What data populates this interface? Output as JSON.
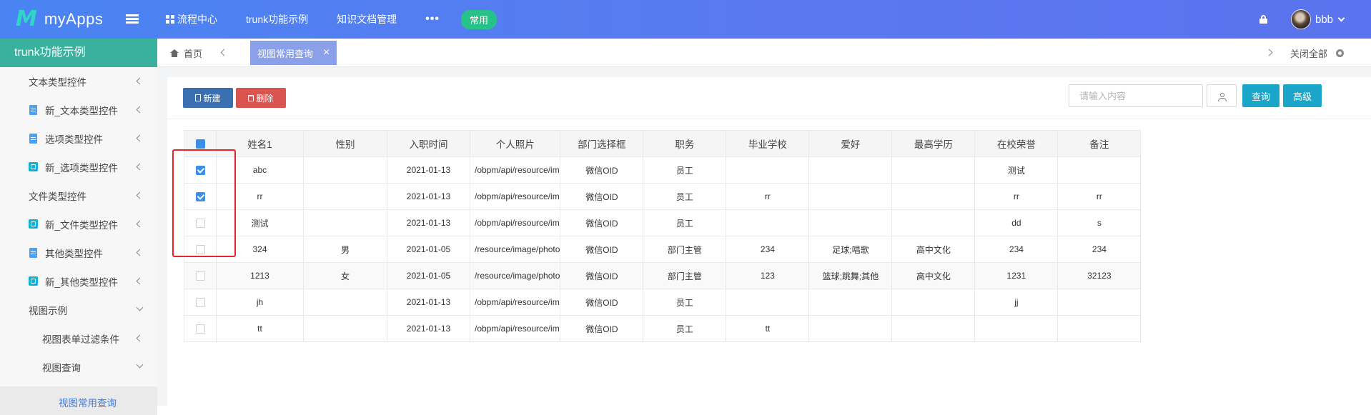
{
  "app": {
    "logo_mark": "M",
    "name": "myApps"
  },
  "topnav": {
    "items": [
      "流程中心",
      "trunk功能示例",
      "知识文档管理"
    ],
    "more": "•••",
    "pill": "常用"
  },
  "user": {
    "name": "bbb"
  },
  "sidebar": {
    "title": "trunk功能示例",
    "items": [
      {
        "label": "文本类型控件",
        "icon": "none",
        "arrow": "left"
      },
      {
        "label": "新_文本类型控件",
        "icon": "doc-icon",
        "arrow": "left"
      },
      {
        "label": "选项类型控件",
        "icon": "doc-icon",
        "arrow": "left"
      },
      {
        "label": "新_选项类型控件",
        "icon": "cube-icon",
        "arrow": "left"
      },
      {
        "label": "文件类型控件",
        "icon": "none",
        "arrow": "left"
      },
      {
        "label": "新_文件类型控件",
        "icon": "cube-icon",
        "arrow": "left"
      },
      {
        "label": "其他类型控件",
        "icon": "doc-icon",
        "arrow": "left"
      },
      {
        "label": "新_其他类型控件",
        "icon": "cube-icon",
        "arrow": "left"
      },
      {
        "label": "视图示例",
        "icon": "none",
        "arrow": "down"
      },
      {
        "label": "视图表单过滤条件",
        "icon": "none",
        "arrow": "left"
      },
      {
        "label": "视图查询",
        "icon": "none",
        "arrow": "down"
      },
      {
        "label": "视图常用查询",
        "icon": "none",
        "arrow": "none"
      }
    ]
  },
  "tabs": {
    "home": "首页",
    "active": "视图常用查询",
    "close_symbol": "×",
    "close_all": "关闭全部"
  },
  "toolbar": {
    "new_label": "新建",
    "delete_label": "删除",
    "search_placeholder": "请输入内容",
    "query_label": "查询",
    "advanced_label": "高级"
  },
  "table": {
    "columns": [
      "姓名1",
      "性别",
      "入职时间",
      "个人照片",
      "部门选择框",
      "职务",
      "毕业学校",
      "爱好",
      "最高学历",
      "在校荣誉",
      "备注"
    ],
    "rows": [
      {
        "checked": true,
        "cells": [
          "abc",
          "",
          "2021-01-13",
          "/obpm/api/resource/im",
          "微信OID",
          "员工",
          "",
          "",
          "",
          "测试",
          ""
        ]
      },
      {
        "checked": true,
        "cells": [
          "rr",
          "",
          "2021-01-13",
          "/obpm/api/resource/im",
          "微信OID",
          "员工",
          "rr",
          "",
          "",
          "rr",
          "rr"
        ]
      },
      {
        "checked": false,
        "cells": [
          "测试",
          "",
          "2021-01-13",
          "/obpm/api/resource/im",
          "微信OID",
          "员工",
          "",
          "",
          "",
          "dd",
          "s"
        ]
      },
      {
        "checked": false,
        "cells": [
          "324",
          "男",
          "2021-01-05",
          "/resource/image/photo",
          "微信OID",
          "部门主管",
          "234",
          "足球;唱歌",
          "高中文化",
          "234",
          "234"
        ]
      },
      {
        "checked": false,
        "cells": [
          "1213",
          "女",
          "2021-01-05",
          "/resource/image/photo",
          "微信OID",
          "部门主管",
          "123",
          "篮球;跳舞;其他",
          "高中文化",
          "1231",
          "32123"
        ]
      },
      {
        "checked": false,
        "cells": [
          "jh",
          "",
          "2021-01-13",
          "/obpm/api/resource/im",
          "微信OID",
          "员工",
          "",
          "",
          "",
          "jj",
          ""
        ]
      },
      {
        "checked": false,
        "cells": [
          "tt",
          "",
          "2021-01-13",
          "/obpm/api/resource/im",
          "微信OID",
          "员工",
          "tt",
          "",
          "",
          "",
          ""
        ]
      }
    ]
  },
  "colors": {
    "topbar": "#4a84f2",
    "sidebar_header": "#3ab09e",
    "active_tab": "#8aa0e8",
    "new_button": "#3a6fb2",
    "delete_button": "#d9534f",
    "query_button": "#1aa5c9",
    "highlight_box": "#e8242b"
  }
}
